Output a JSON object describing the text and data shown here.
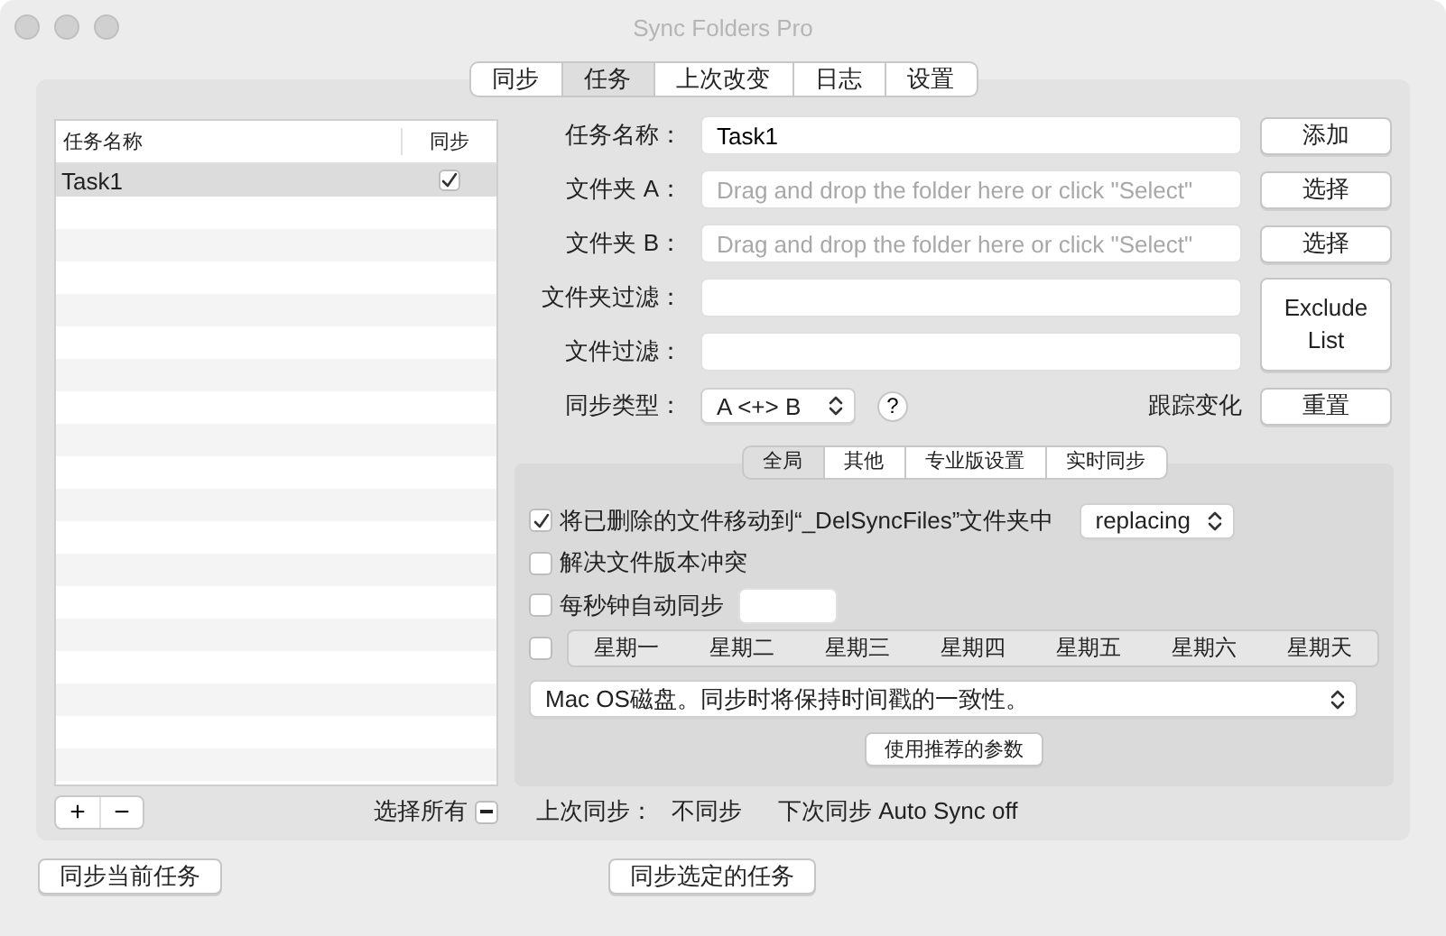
{
  "window": {
    "title": "Sync Folders Pro"
  },
  "tabs": [
    {
      "label": "同步",
      "selected": false
    },
    {
      "label": "任务",
      "selected": true
    },
    {
      "label": "上次改变",
      "selected": false
    },
    {
      "label": "日志",
      "selected": false
    },
    {
      "label": "设置",
      "selected": false
    }
  ],
  "task_list": {
    "columns": [
      "任务名称",
      "同步"
    ],
    "rows": [
      {
        "name": "Task1",
        "checked": true,
        "selected": true
      }
    ],
    "add_button": "+",
    "remove_button": "−",
    "select_all": {
      "label": "选择所有",
      "mixed": true
    }
  },
  "form": {
    "rows": [
      {
        "label": "任务名称：",
        "value": "Task1",
        "button": "添加"
      },
      {
        "label": "文件夹 A：",
        "placeholder": "Drag and drop the folder here or click \"Select\"",
        "button": "选择"
      },
      {
        "label": "文件夹 B：",
        "placeholder": "Drag and drop the folder here or click \"Select\"",
        "button": "选择"
      },
      {
        "label": "文件夹过滤："
      },
      {
        "label": "文件过滤："
      }
    ],
    "exclude_button": "Exclude List",
    "sync_type": {
      "label": "同步类型：",
      "value": "A <+> B",
      "help": "?"
    },
    "track_changes": {
      "label": "跟踪变化",
      "button": "重置"
    }
  },
  "subtabs": [
    {
      "label": "全局",
      "selected": true
    },
    {
      "label": "其他",
      "selected": false
    },
    {
      "label": "专业版设置",
      "selected": false
    },
    {
      "label": "实时同步",
      "selected": false
    }
  ],
  "options": [
    {
      "kind": "checkbox",
      "label": "将已删除的文件移动到“_DelSyncFiles”文件夹中",
      "checked": true,
      "select": "replacing"
    },
    {
      "kind": "checkbox",
      "label": "解决文件版本冲突",
      "checked": false
    },
    {
      "kind": "checkbox",
      "label": "每秒钟自动同步",
      "checked": false,
      "field": true
    },
    {
      "kind": "weekdays",
      "checked": false,
      "days": [
        "星期一",
        "星期二",
        "星期三",
        "星期四",
        "星期五",
        "星期六",
        "星期天"
      ]
    }
  ],
  "disk_select": "Mac OS磁盘。同步时将保持时间戳的一致性。",
  "recommend_button": "使用推荐的参数",
  "status": {
    "last_sync_label": "上次同步：",
    "last_sync_value": "不同步",
    "next_sync": "下次同步 Auto Sync off"
  },
  "footer_buttons": [
    "同步当前任务",
    "同步选定的任务"
  ]
}
